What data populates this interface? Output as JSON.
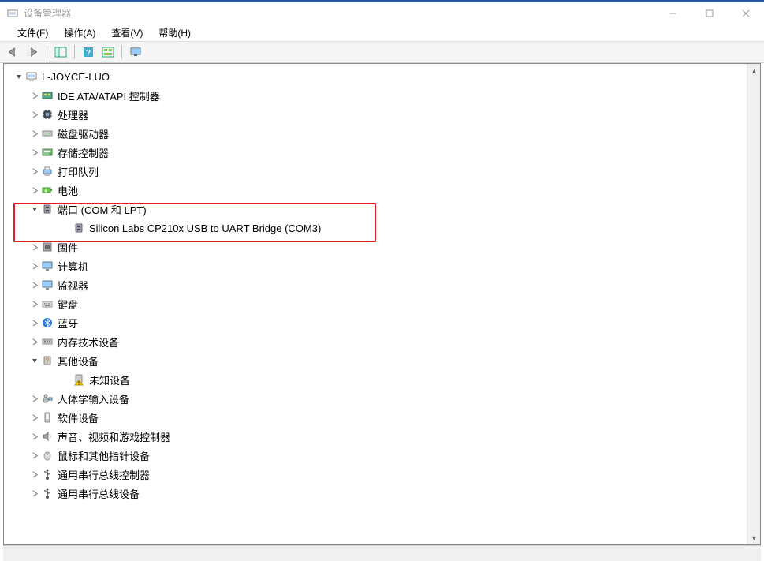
{
  "window": {
    "title": "设备管理器"
  },
  "menu": {
    "file": "文件(F)",
    "action": "操作(A)",
    "view": "查看(V)",
    "help": "帮助(H)"
  },
  "computer_name": "L-JOYCE-LUO",
  "nodes": {
    "ide": "IDE ATA/ATAPI 控制器",
    "cpu": "处理器",
    "disk": "磁盘驱动器",
    "storage": "存储控制器",
    "printq": "打印队列",
    "battery": "电池",
    "ports": "端口 (COM 和 LPT)",
    "ports_child": "Silicon Labs CP210x USB to UART Bridge (COM3)",
    "firmware": "固件",
    "computer": "计算机",
    "monitor": "监视器",
    "keyboard": "键盘",
    "bluetooth": "蓝牙",
    "memory": "内存技术设备",
    "other": "其他设备",
    "other_child": "未知设备",
    "hid": "人体学输入设备",
    "software": "软件设备",
    "sound": "声音、视频和游戏控制器",
    "mouse": "鼠标和其他指针设备",
    "usb_ctrl": "通用串行总线控制器",
    "usb_dev": "通用串行总线设备"
  }
}
